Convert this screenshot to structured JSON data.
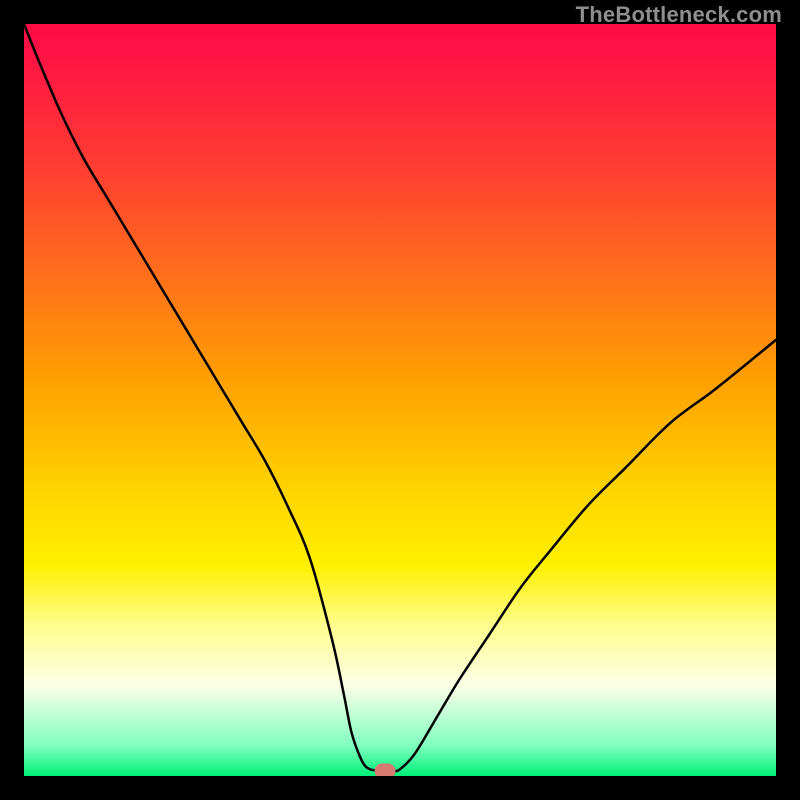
{
  "watermark": "TheBottleneck.com",
  "chart_data": {
    "type": "line",
    "title": "",
    "xlabel": "",
    "ylabel": "",
    "x": [
      0,
      2,
      5,
      8,
      11,
      14,
      17,
      20,
      23,
      26,
      29,
      32,
      35,
      38,
      41,
      42.5,
      43.5,
      44.5,
      45.5,
      47,
      49,
      50,
      52,
      55,
      58,
      62,
      66,
      70,
      75,
      80,
      86,
      92,
      100
    ],
    "values": [
      100,
      95,
      88,
      82,
      77,
      72,
      67,
      62,
      57,
      52,
      47,
      42,
      36,
      29,
      18,
      11,
      6,
      3,
      1.2,
      0.7,
      0.7,
      0.9,
      3,
      8,
      13,
      19,
      25,
      30,
      36,
      41,
      47,
      51.5,
      58
    ],
    "xlim": [
      0,
      100
    ],
    "ylim": [
      0,
      100
    ],
    "marker": {
      "x": 48.0,
      "y": 0.6
    },
    "gradient": {
      "stops": [
        {
          "pos": 0,
          "color": "#ff0b45"
        },
        {
          "pos": 18,
          "color": "#ff3a33"
        },
        {
          "pos": 48,
          "color": "#ffa200"
        },
        {
          "pos": 72,
          "color": "#fff000"
        },
        {
          "pos": 96,
          "color": "#7fffbf"
        },
        {
          "pos": 100,
          "color": "#00ef78"
        }
      ]
    }
  }
}
